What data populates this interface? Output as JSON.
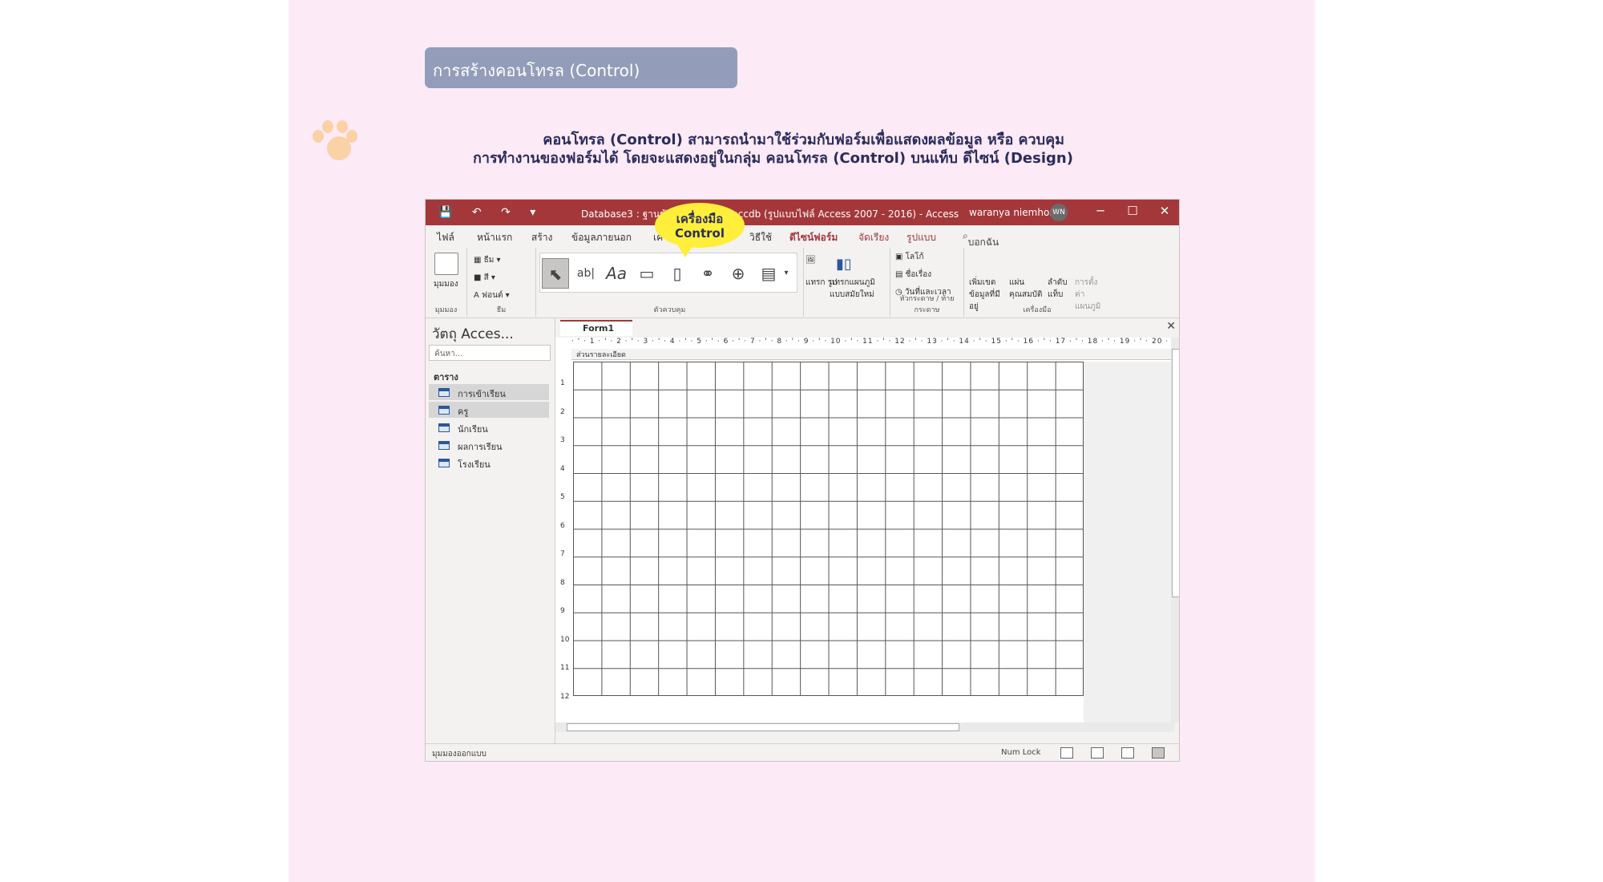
{
  "slide": {
    "title": "การสร้างคอนโทรล (Control)",
    "description_line1": "คอนโทรล (Control) สามารถนำมาใช้ร่วมกับฟอร์มเพื่อแสดงผลข้อมูล หรือ ควบคุม",
    "description_line2": "การทำงานของฟอร์มได้ โดยจะแสดงอยู่ในกลุ่ม คอนโทรล (Control) บนแท็บ ดีไซน์ (Design)"
  },
  "callout": {
    "line1": "เครื่องมือ",
    "line2": "Control"
  },
  "titlebar": {
    "document": "Database3 : ฐานข้อมูล- ...base3.accdb (รูปแบบไฟล์ Access 2007 - 2016) - Access",
    "user": "waranya niemhom",
    "avatar": "WN",
    "minimize": "─",
    "maximize": "☐",
    "close": "✕"
  },
  "tabs": {
    "file": "ไฟล์",
    "home": "หน้าแรก",
    "create": "สร้าง",
    "external": "ข้อมูลภายนอก",
    "tools": "เค",
    "help": "วิธีใช้",
    "form_design": "ดีไซน์ฟอร์ม",
    "arrange": "จัดเรียง",
    "format": "รูปแบบ",
    "tellme": "บอกฉันว่าคุณต้องการทำอะไร"
  },
  "ribbon": {
    "views_button": "มุมมอง",
    "views_group": "มุมมอง",
    "themes_item": "ธีม",
    "colors_item": "สี",
    "fonts_item": "ฟอนต์",
    "themes_group": "ธีม",
    "controls_group": "ตัวควบคุม",
    "insert_image": "แทรก รูป",
    "insert_chart": "แทรกแผนภูมิ แบบสมัยใหม่",
    "logo": "โลโก้",
    "title": "ชื่อเรื่อง",
    "datetime": "วันที่และเวลา",
    "header_group": "หัวกระดาษ / ท้ายกระดาษ",
    "add_fields": "เพิ่มเขตข้อมูลที่มีอยู่",
    "property_sheet": "แผ่นคุณสมบัติ",
    "tab_order": "ลำดับแท็บ",
    "chart_settings": "การตั้งค่าแผนภูมิ",
    "tools_group": "เครื่องมือ",
    "text_box_tool": "ab|",
    "label_tool": "Aa"
  },
  "nav": {
    "title": "วัตถุ Acces...",
    "search_placeholder": "ค้นหา...",
    "group": "ตาราง",
    "items": [
      "การเข้าเรียน",
      "ครู",
      "นักเรียน",
      "ผลการเรียน",
      "โรงเรียน"
    ]
  },
  "document": {
    "tab": "Form1",
    "section": "ส่วนรายละเอียด",
    "ruler": "· ' · 1 · ' · 2 · ' · 3 · ' · 4 · ' · 5 · ' · 6 · ' · 7 · ' · 8 · ' · 9 · ' · 10 · ' · 11 · ' · 12 · ' · 13 · ' · 14 · ' · 15 · ' · 16 · ' · 17 · ' · 18 · ' · 19 · ' · 20 ·",
    "vruler": [
      "1",
      "2",
      "3",
      "4",
      "5",
      "6",
      "7",
      "8",
      "9",
      "10",
      "11",
      "12"
    ]
  },
  "status": {
    "mode": "มุมมองออกแบบ",
    "numlock": "Num Lock"
  }
}
